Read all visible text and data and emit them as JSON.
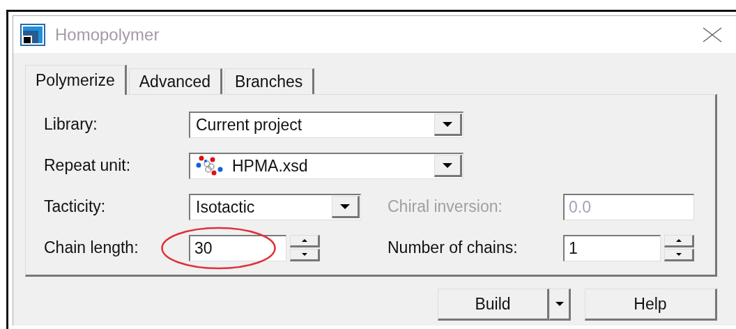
{
  "window": {
    "title": "Homopolymer"
  },
  "tabs": [
    {
      "label": "Polymerize",
      "selected": true
    },
    {
      "label": "Advanced",
      "selected": false
    },
    {
      "label": "Branches",
      "selected": false
    }
  ],
  "rows": [
    {
      "left": {
        "kind": "combo",
        "label": "Library:",
        "value": "Current project"
      }
    },
    {
      "left": {
        "kind": "file_combo",
        "label": "Repeat unit:",
        "value": "HPMA.xsd"
      }
    },
    {
      "left": {
        "kind": "short_combo",
        "label": "Tacticity:",
        "value": "Isotactic"
      },
      "right": {
        "kind": "text",
        "label": "Chiral inversion:",
        "value": "0.0",
        "disabled": true
      }
    },
    {
      "left": {
        "kind": "spin",
        "label": "Chain length:",
        "value": "30",
        "highlighted": true
      },
      "right": {
        "kind": "spin",
        "label": "Number of chains:",
        "value": "1",
        "disabled": false
      }
    }
  ],
  "buttons": [
    {
      "kind": "split",
      "label": "Build"
    },
    {
      "kind": "plain",
      "label": "Help"
    }
  ]
}
